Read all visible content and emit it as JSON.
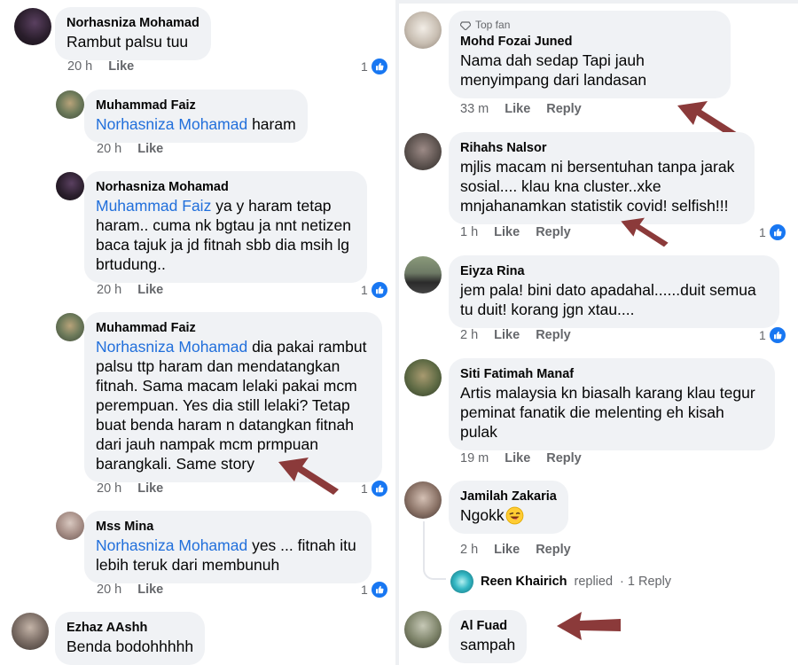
{
  "left": {
    "comments": [
      {
        "name": "Norhasniza Mohamad",
        "text": "Rambut palsu tuu",
        "time": "20 h",
        "like": "Like",
        "reactions": "1"
      },
      {
        "name": "Muhammad Faiz",
        "mention": "Norhasniza Mohamad",
        "text": " haram",
        "time": "20 h",
        "like": "Like"
      },
      {
        "name": "Norhasniza Mohamad",
        "mention": "Muhammad Faiz",
        "text": " ya y haram tetap haram.. cuma nk bgtau ja nnt netizen baca tajuk ja jd fitnah sbb dia msih lg brtudung..",
        "time": "20 h",
        "like": "Like",
        "reactions": "1"
      },
      {
        "name": "Muhammad Faiz",
        "mention": "Norhasniza Mohamad",
        "text": " dia pakai rambut palsu ttp haram dan mendatangkan fitnah. Sama macam lelaki pakai mcm perempuan. Yes dia still lelaki? Tetap buat benda haram n datangkan fitnah dari jauh nampak mcm prmpuan barangkali. Same story",
        "time": "20 h",
        "like": "Like",
        "reactions": "1"
      },
      {
        "name": "Mss Mina",
        "mention": "Norhasniza Mohamad",
        "text": " yes ... fitnah itu lebih teruk dari membunuh",
        "time": "20 h",
        "like": "Like",
        "reactions": "1"
      },
      {
        "name": "Ezhaz AAshh",
        "text": "Benda bodohhhhh"
      }
    ]
  },
  "right": {
    "comments": [
      {
        "badge": "Top fan",
        "name": "Mohd Fozai Juned",
        "text": "Nama dah sedap Tapi jauh menyimpang dari landasan",
        "time": "33 m",
        "like": "Like",
        "reply": "Reply"
      },
      {
        "name": "Rihahs Nalsor",
        "text": "mjlis macam ni bersentuhan tanpa jarak sosial.... klau kna cluster..xke mnjahanamkan statistik covid! selfish!!!",
        "time": "1 h",
        "like": "Like",
        "reply": "Reply",
        "reactions": "1"
      },
      {
        "name": "Eiyza Rina",
        "text": "jem pala!  bini dato apadahal......duit semua tu duit! korang jgn xtau....",
        "time": "2 h",
        "like": "Like",
        "reply": "Reply",
        "reactions": "1"
      },
      {
        "name": "Siti Fatimah Manaf",
        "text": "Artis malaysia kn biasalh karang klau tegur peminat fanatik die melenting eh kisah pulak",
        "time": "19 m",
        "like": "Like",
        "reply": "Reply"
      },
      {
        "name": "Jamilah Zakaria",
        "text": "Ngokk",
        "time": "2 h",
        "like": "Like",
        "reply": "Reply"
      },
      {
        "name": "Al Fuad",
        "text": "sampah"
      }
    ],
    "replied": {
      "name": "Reen Khairich",
      "action": "replied",
      "count": "· 1 Reply"
    }
  },
  "colors": {
    "bubble": "#f0f2f5",
    "mention": "#216fdb",
    "meta": "#65676b",
    "like_badge": "#1877f2",
    "arrow": "#8b3a3a"
  },
  "icons": [
    "thumbs-up-icon",
    "diamond-icon",
    "grinning-face-emoji",
    "annotation-arrow"
  ]
}
